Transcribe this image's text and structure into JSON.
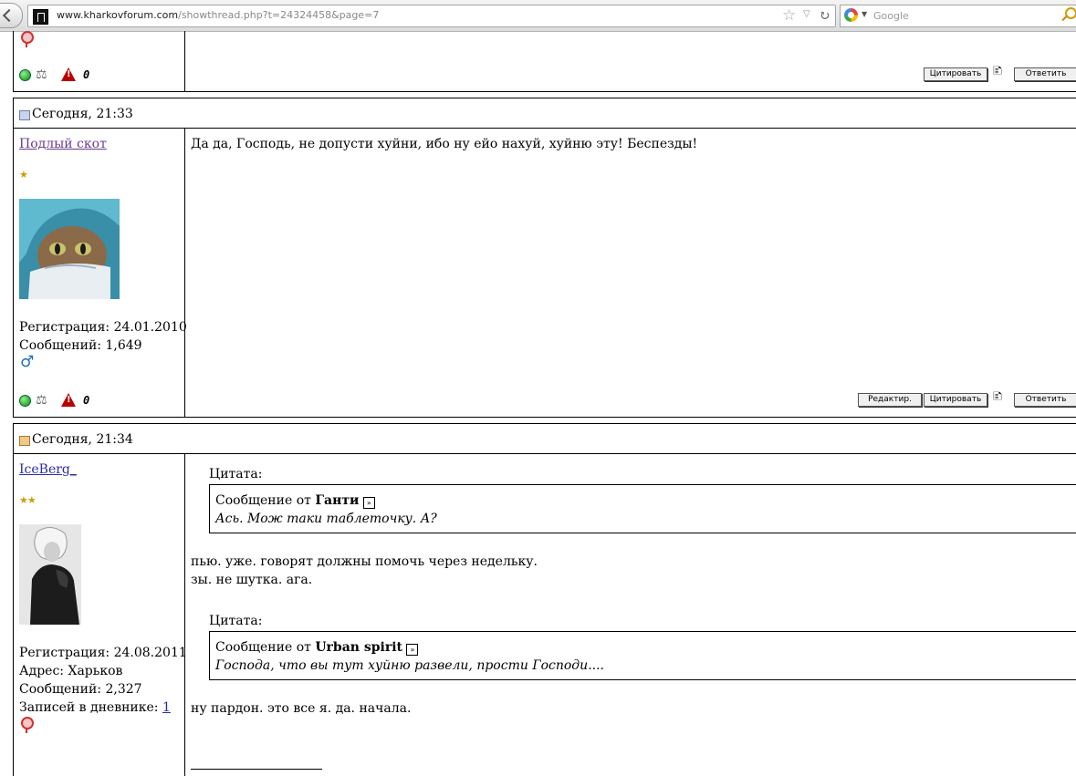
{
  "browser": {
    "url_host": "www.kharkovforum.com",
    "url_path": "/showthread.php?t=24324458&page=7",
    "search_placeholder": "Google"
  },
  "posts": [
    {
      "buttons": {
        "quote": "Цитировать",
        "reply": "Ответить"
      },
      "reputation": "0"
    },
    {
      "date": "Сегодня, 21:33",
      "username": "Подлый скот",
      "stars": "★",
      "registration": "Регистрация: 24.01.2010",
      "messages": "Сообщений: 1,649",
      "body": "Да да, Господь, не допусти хуйни, ибо ну ейо нахуй, хуйню эту! Беспезды!",
      "buttons": {
        "edit": "Редактир.",
        "quote": "Цитировать",
        "reply": "Ответить"
      },
      "reputation": "0"
    },
    {
      "date": "Сегодня, 21:34",
      "username": "IceBerg_",
      "stars": "★★",
      "registration": "Регистрация: 24.08.2011",
      "address": "Адрес: Харьков",
      "messages": "Сообщений: 2,327",
      "diary_label": "Записей в дневнике: ",
      "diary_count": "1",
      "quotes": [
        {
          "label": "Цитата:",
          "prefix": "Сообщение от ",
          "author": "Ганти",
          "text": "Ась. Мож таки таблеточку. А?"
        },
        {
          "label": "Цитата:",
          "prefix": "Сообщение от ",
          "author": "Urban spirit",
          "text": "Господа, что вы тут хуйню развели, прости Господи...."
        }
      ],
      "body_line1": "пью. уже. говорят должны помочь через недельку.",
      "body_line2": "зы. не шутка. ага.",
      "body_line3": "ну пардон. это все я. да. начала."
    }
  ]
}
